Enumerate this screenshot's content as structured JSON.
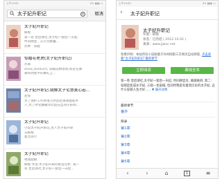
{
  "left": {
    "status_time": "上午10:00",
    "status_right": "4G ▮▮▮ ▭",
    "search": {
      "value": "太子妃升职记",
      "cancel": "取消"
    },
    "results": [
      {
        "title": "太子妃升职记",
        "line1": "鲜橙",
        "line2": "第一卷 皇后请社,太子妃一套后一天起,",
        "line3": "时间顾显 , 公子无赖暮...",
        "line4": "完本 · 穿越",
        "cover": "#d9b7a9"
      },
      {
        "title": "惊婚花老虎(太子妃升职记)",
        "line1": "苏菲",
        "line2": "zhow_book20], 穿越前顾客吧,陈近在暴",
        "line3": "暴和周星宇的婚礼上...",
        "line4": "",
        "cover": "#b67d9a"
      },
      {
        "title": "太子妃升职记:镜像太子宅慧美心若...",
        "line1": "若瑶",
        "line2": "为了保护工作失落万所后走来感能家乡",
        "line3": "人,为了所化做破顶云仙在自叫子好和...",
        "line4": "",
        "cover": "#6b7fa6"
      },
      {
        "title": "太子妃升职记",
        "line1": "小说太子妃升职记,主人太子妃升职",
        "line2": "记鲜橙",
        "line3": "暂无简介",
        "line4": "",
        "cover": "#8aa3c8"
      },
      {
        "title": "太子妃升职记",
        "line1": "嘿咕姑娘",
        "line2": "鲜橙 文案'太子妃升职的职业分析. 第一",
        "line3": "卷 皇后请社,太子妃一套后一天起...",
        "line4": "",
        "cover": "#7e9a55"
      }
    ]
  },
  "right": {
    "status_time": "上午10:00",
    "status_right": "4G ▮▮▮ ▭",
    "header_title": "太子妃升职记",
    "book": {
      "title": "太子妃升职记",
      "author": "作者：鲜橙",
      "status": "状态：已完结 ( 2012-12-02 )",
      "source": "来源：www.jjwxc.net"
    },
    "notice_text": "免费声明：本站所有小说收集于许村网第三方网页自动抓取, ",
    "notice_link": "点击查看“太子妃升职记”最新章节",
    "btn_read": "立即阅读",
    "btn_download": "离线全本",
    "summary": "第一卷 皇后请社,太子妃一套后一天起, 时间顾显太, 雌雄难辨, 第二：穿越后变成太子妃, 三观一金崩塌, 但同时我是有着黑历史的太子妃, 这什么穿越人生才好......",
    "summary_more": "展开详情",
    "latest_label": "最新章节",
    "latest_value": "番外",
    "toc_label": "目录",
    "chapters": [
      "第1章",
      "第2章",
      "第3章",
      "第4章",
      "第5章"
    ],
    "bottom": {
      "back": "‹",
      "forward": "›",
      "home": "⌂",
      "pages": "1",
      "menu": "≡"
    }
  },
  "colors": {
    "green": "#58b746",
    "link": "#2f6fd8"
  }
}
